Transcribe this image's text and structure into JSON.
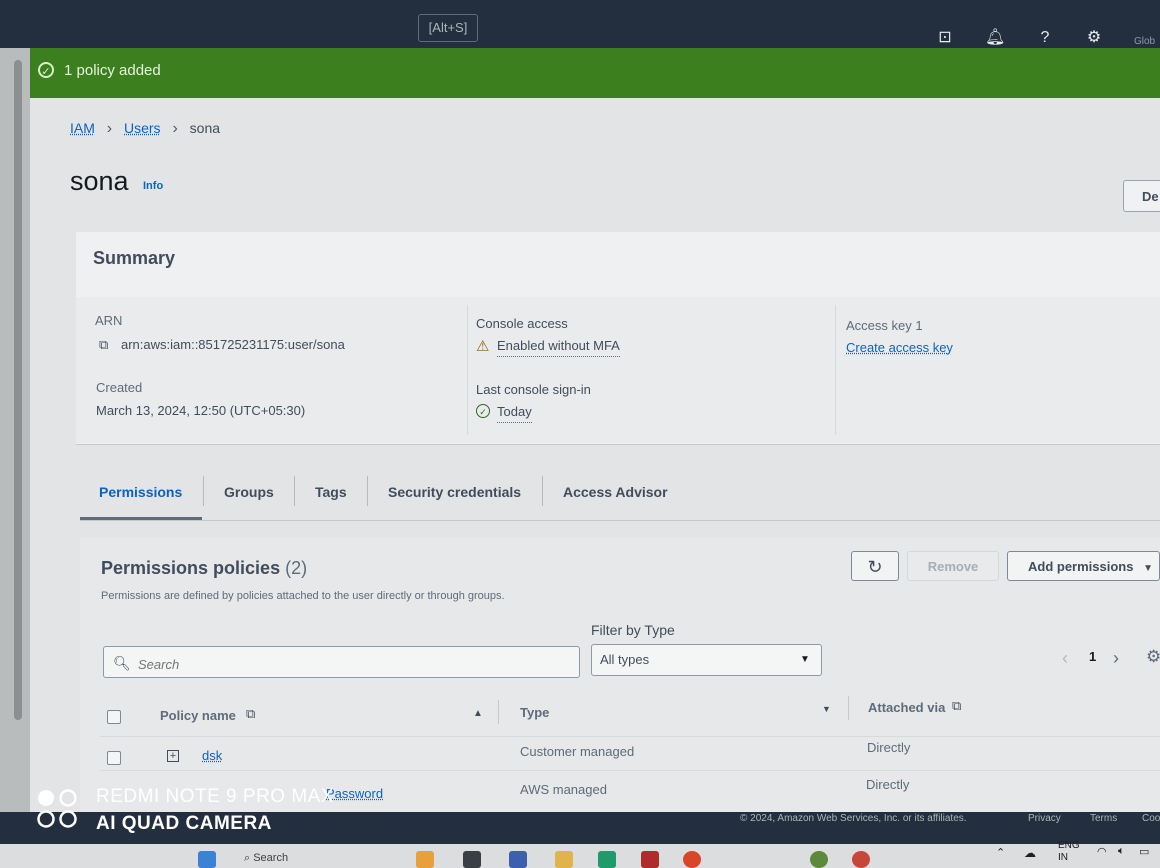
{
  "topbar": {
    "search_shortcut": "[Alt+S]",
    "region_text": "Glob"
  },
  "flash": {
    "message": "1 policy added"
  },
  "breadcrumb": {
    "items": [
      "IAM",
      "Users",
      "sona"
    ]
  },
  "user": {
    "name": "sona",
    "info_label": "Info",
    "delete_label": "De"
  },
  "summary": {
    "title": "Summary",
    "arn_label": "ARN",
    "arn_value": "arn:aws:iam::851725231175:user/sona",
    "created_label": "Created",
    "created_value": "March 13, 2024, 12:50 (UTC+05:30)",
    "console_access_label": "Console access",
    "console_access_value": "Enabled without MFA",
    "last_signin_label": "Last console sign-in",
    "last_signin_value": "Today",
    "access_key_label": "Access key 1",
    "access_key_value": "Create access key"
  },
  "tabs": [
    "Permissions",
    "Groups",
    "Tags",
    "Security credentials",
    "Access Advisor"
  ],
  "permissions": {
    "title": "Permissions policies",
    "count": "(2)",
    "description": "Permissions are defined by policies attached to the user directly or through groups.",
    "refresh_icon": "refresh-icon",
    "remove_label": "Remove",
    "add_label": "Add permissions",
    "filter_label": "Filter by Type",
    "search_placeholder": "Search",
    "type_value": "All types",
    "page_number": "1",
    "columns": [
      "Policy name",
      "Type",
      "Attached via"
    ],
    "rows": [
      {
        "name": "dsk",
        "type": "Customer managed",
        "attached": "Directly"
      },
      {
        "name": "Password",
        "type": "AWS managed",
        "attached": "Directly"
      }
    ]
  },
  "footer": {
    "copyright": "© 2024, Amazon Web Services, Inc. or its affiliates.",
    "privacy": "Privacy",
    "terms": "Terms",
    "cookie": "Coo"
  },
  "taskbar": {
    "search_text": "Search",
    "lang_line1": "ENG",
    "lang_line2": "IN"
  },
  "watermark": {
    "line1": "REDMI NOTE 9 PRO MAX",
    "line2": "AI QUAD CAMERA"
  },
  "colors": {
    "aws_dark": "#232f3e",
    "success_green": "#3b7f1f",
    "link_blue": "#0b63c4",
    "warning": "#8d6605"
  }
}
